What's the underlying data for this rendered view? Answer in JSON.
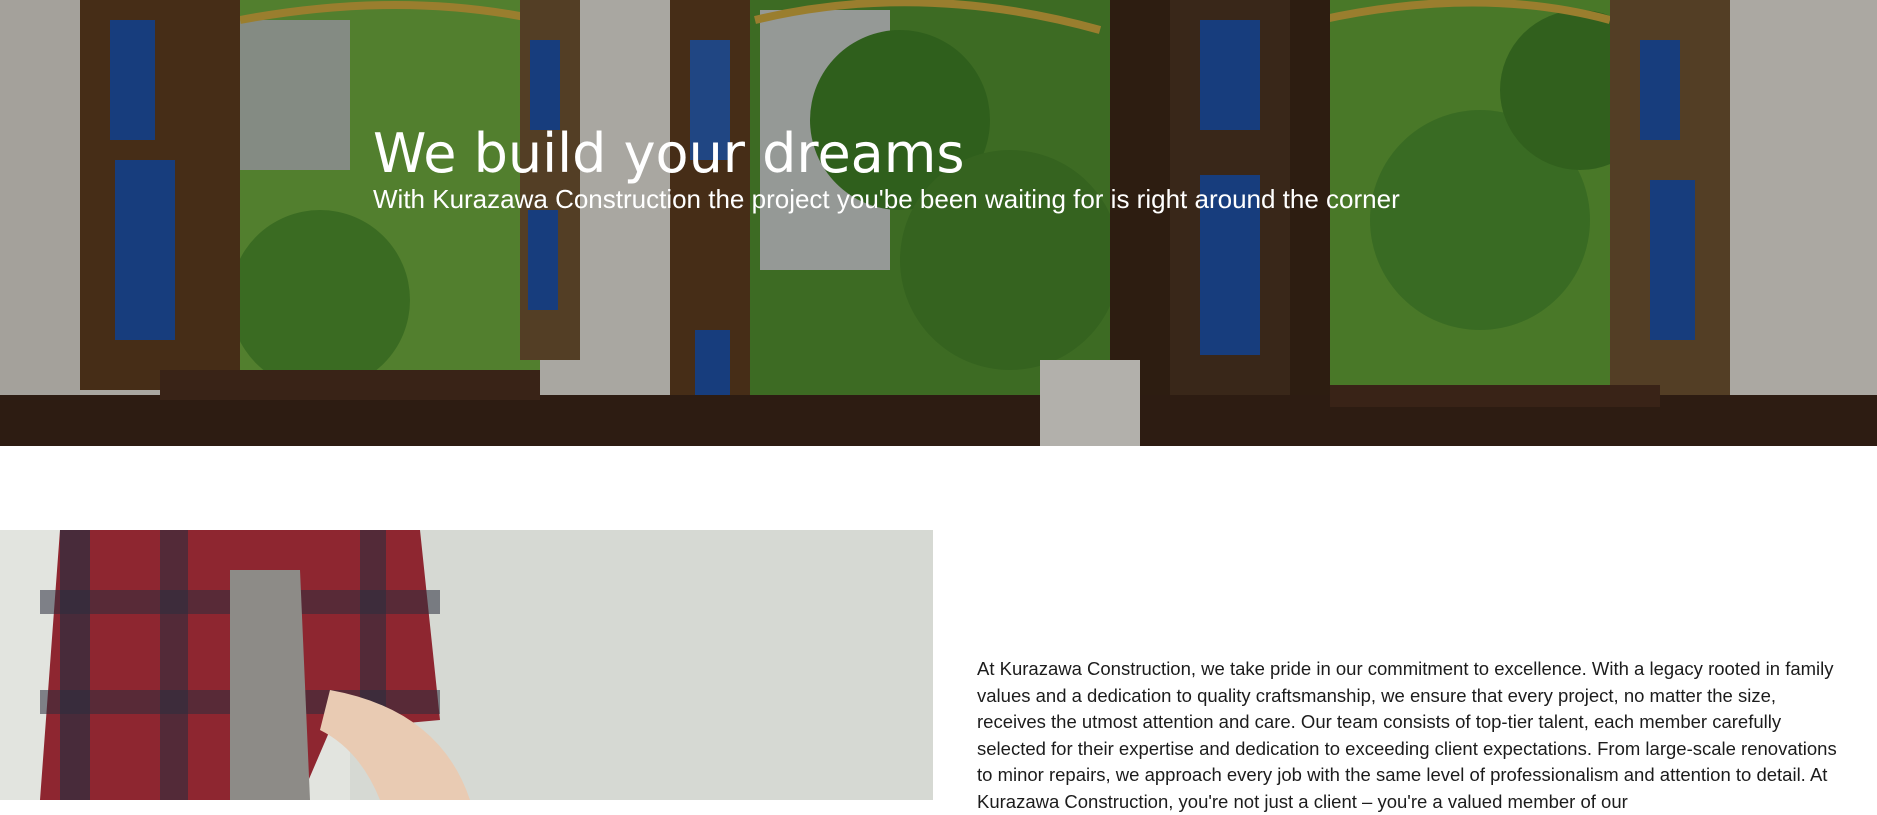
{
  "hero": {
    "title": "We build your dreams",
    "subtitle": "With Kurazawa Construction the project you'be been waiting for is right around the corner",
    "image_description_icon": "window-landscape-image"
  },
  "about": {
    "image_icon": "worker-image",
    "paragraph": "At Kurazawa Construction, we take pride in our commitment to excellence. With a legacy rooted in family values and a dedication to quality craftsmanship, we ensure that every project, no matter the size, receives the utmost attention and care. Our team consists of top-tier talent, each member carefully selected for their expertise and dedication to exceeding client expectations. From large-scale renovations to minor repairs, we approach every job with the same level of professionalism and attention to detail. At Kurazawa Construction, you're not just a client – you're a valued member of our"
  },
  "colors": {
    "hero_text": "#ffffff",
    "body_text": "#1c1c1c",
    "foliage": "#4f8a2e",
    "shutter_blue": "#1e4fa0",
    "wood": "#5a3a1e"
  }
}
